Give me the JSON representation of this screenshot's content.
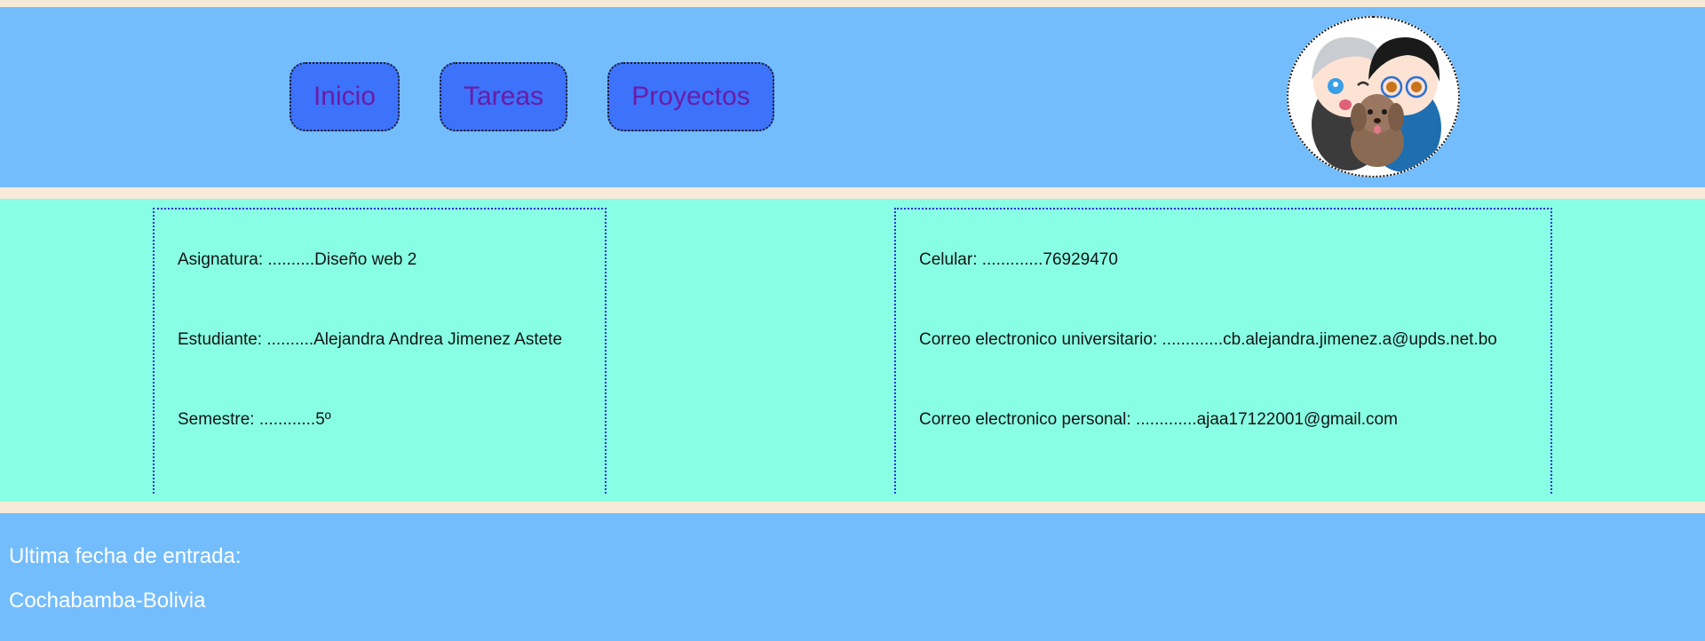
{
  "nav": {
    "items": [
      {
        "label": "Inicio"
      },
      {
        "label": "Tareas"
      },
      {
        "label": "Proyectos"
      }
    ]
  },
  "avatar": {
    "icon": "avatar-image",
    "description_visible": false
  },
  "info_left": {
    "lines": [
      "Asignatura: ..........Diseño web 2",
      "Estudiante: ..........Alejandra Andrea Jimenez Astete",
      "Semestre: ............5º"
    ]
  },
  "info_right": {
    "lines": [
      "Celular: .............76929470",
      "Correo electronico universitario: .............cb.alejandra.jimenez.a@upds.net.bo",
      "Correo electronico personal: .............ajaa17122001@gmail.com"
    ]
  },
  "footer": {
    "last_entry": "Ultima fecha de entrada:",
    "location": "Cochabamba-Bolivia"
  },
  "colors": {
    "page_background": "#f7ead8",
    "header_background": "#74bdfc",
    "nav_button": "#3d72fb",
    "nav_text": "#6a1ca7",
    "info_background": "#88ffe4",
    "info_border": "#2a2ae6",
    "footer_text": "#ffffff"
  }
}
